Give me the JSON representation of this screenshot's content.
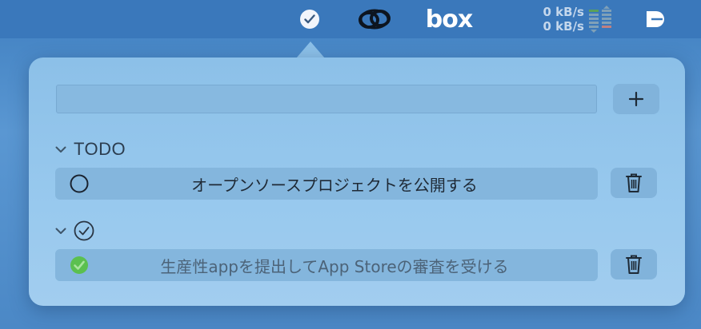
{
  "menubar": {
    "items": [
      {
        "name": "todo-checkmark-icon"
      },
      {
        "name": "creative-cloud-icon"
      },
      {
        "name": "box-logo",
        "label": "box"
      },
      {
        "name": "network-monitor",
        "up": "0 kB/s",
        "down": "0 kB/s"
      },
      {
        "name": "network-activity-meter-icon"
      },
      {
        "name": "d-app-icon"
      }
    ],
    "network": {
      "upload": "0 kB/s",
      "download": "0 kB/s"
    }
  },
  "popover": {
    "new_task": {
      "value": "",
      "placeholder": ""
    },
    "add_button": {
      "icon": "plus-icon"
    },
    "sections": [
      {
        "title": "TODO",
        "expanded": true,
        "tasks": [
          {
            "text": "オープンソースプロジェクトを公開する",
            "done": false
          }
        ]
      },
      {
        "title": "",
        "icon": "completed-checkmark-icon",
        "expanded": true,
        "tasks": [
          {
            "text": "生産性appを提出してApp Storeの審査を受ける",
            "done": true
          }
        ]
      }
    ]
  },
  "colors": {
    "accent_done": "#5bc04f",
    "popover_bg": "#94c6ec",
    "desktop_bg": "#4b88c6"
  }
}
